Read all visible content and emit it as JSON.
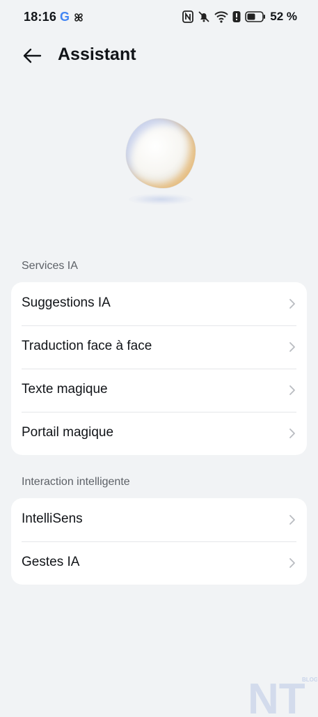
{
  "status_bar": {
    "time": "18:16",
    "battery_percent": "52 %",
    "left_icons": [
      "google-icon",
      "pinwheel-icon"
    ],
    "right_icons": [
      "nfc-icon",
      "muted-bell-icon",
      "wifi-icon",
      "alert-icon",
      "battery-icon"
    ]
  },
  "header": {
    "title": "Assistant"
  },
  "sections": [
    {
      "title": "Services IA",
      "items": [
        {
          "label": "Suggestions IA"
        },
        {
          "label": "Traduction face à face"
        },
        {
          "label": "Texte magique"
        },
        {
          "label": "Portail magique"
        }
      ]
    },
    {
      "title": "Interaction intelligente",
      "items": [
        {
          "label": "IntelliSens"
        },
        {
          "label": "Gestes IA"
        }
      ]
    }
  ],
  "watermark": {
    "text": "NT",
    "sub": "BLOG"
  },
  "colors": {
    "background": "#f1f3f5",
    "card": "#ffffff",
    "text": "#111418",
    "secondary_text": "#5d6167",
    "chevron": "#b9bcc1"
  }
}
